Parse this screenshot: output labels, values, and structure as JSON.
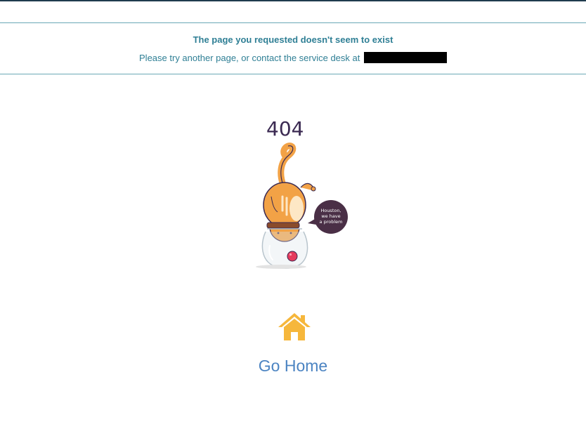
{
  "notice": {
    "title": "The page you requested doesn't seem to exist",
    "message": "Please try another page, or contact the service desk at",
    "contact_redacted": true
  },
  "illustration": {
    "code": "404",
    "speech_line1": "Houston,",
    "speech_line2": "we have",
    "speech_line3": "a problem",
    "icon": "cat-in-fishbowl-illustration"
  },
  "home": {
    "icon": "home-icon",
    "label": "Go Home",
    "icon_color": "#f6b73c",
    "link_color": "#4c84c2"
  },
  "colors": {
    "notice_text": "#2f7f95",
    "divider": "#6aa8b6",
    "top_bar": "#1f3b4d"
  }
}
